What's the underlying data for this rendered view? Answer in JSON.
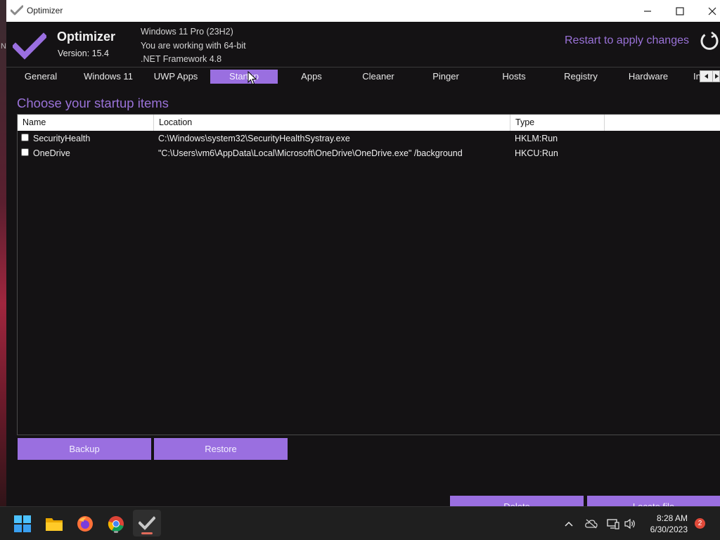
{
  "window": {
    "title": "Optimizer"
  },
  "desktop": {
    "edge_text": "N"
  },
  "header": {
    "app_name": "Optimizer",
    "version": "Version: 15.4",
    "os": "Windows 11 Pro (23H2)",
    "arch": "You are working with 64-bit",
    "framework": ".NET Framework 4.8",
    "restart_text": "Restart to apply changes"
  },
  "tabs": [
    {
      "label": "General"
    },
    {
      "label": "Windows 11"
    },
    {
      "label": "UWP Apps"
    },
    {
      "label": "Startup",
      "active": true
    },
    {
      "label": "Apps"
    },
    {
      "label": "Cleaner"
    },
    {
      "label": "Pinger"
    },
    {
      "label": "Hosts"
    },
    {
      "label": "Registry"
    },
    {
      "label": "Hardware"
    },
    {
      "label": "In"
    }
  ],
  "main": {
    "section_title": "Choose your startup items",
    "columns": [
      "Name",
      "Location",
      "Type"
    ],
    "rows": [
      {
        "name": "SecurityHealth",
        "location": "C:\\Windows\\system32\\SecurityHealthSystray.exe",
        "type": "HKLM:Run",
        "checked": false
      },
      {
        "name": "OneDrive",
        "location": "\"C:\\Users\\vm6\\AppData\\Local\\Microsoft\\OneDrive\\OneDrive.exe\" /background",
        "type": "HKCU:Run",
        "checked": false
      }
    ],
    "backup_label": "Backup",
    "restore_label": "Restore",
    "delete_label": "Delete",
    "locate_label": "Locate file"
  },
  "taskbar": {
    "time": "8:28 AM",
    "date": "6/30/2023",
    "notification_count": "2",
    "pinned": [
      "windows-start-icon",
      "file-explorer-icon",
      "firefox-icon",
      "chrome-icon",
      "optimizer-icon"
    ]
  },
  "colors": {
    "accent": "#9a6fe0",
    "accent_text": "#9a72d8",
    "background": "#141214"
  }
}
